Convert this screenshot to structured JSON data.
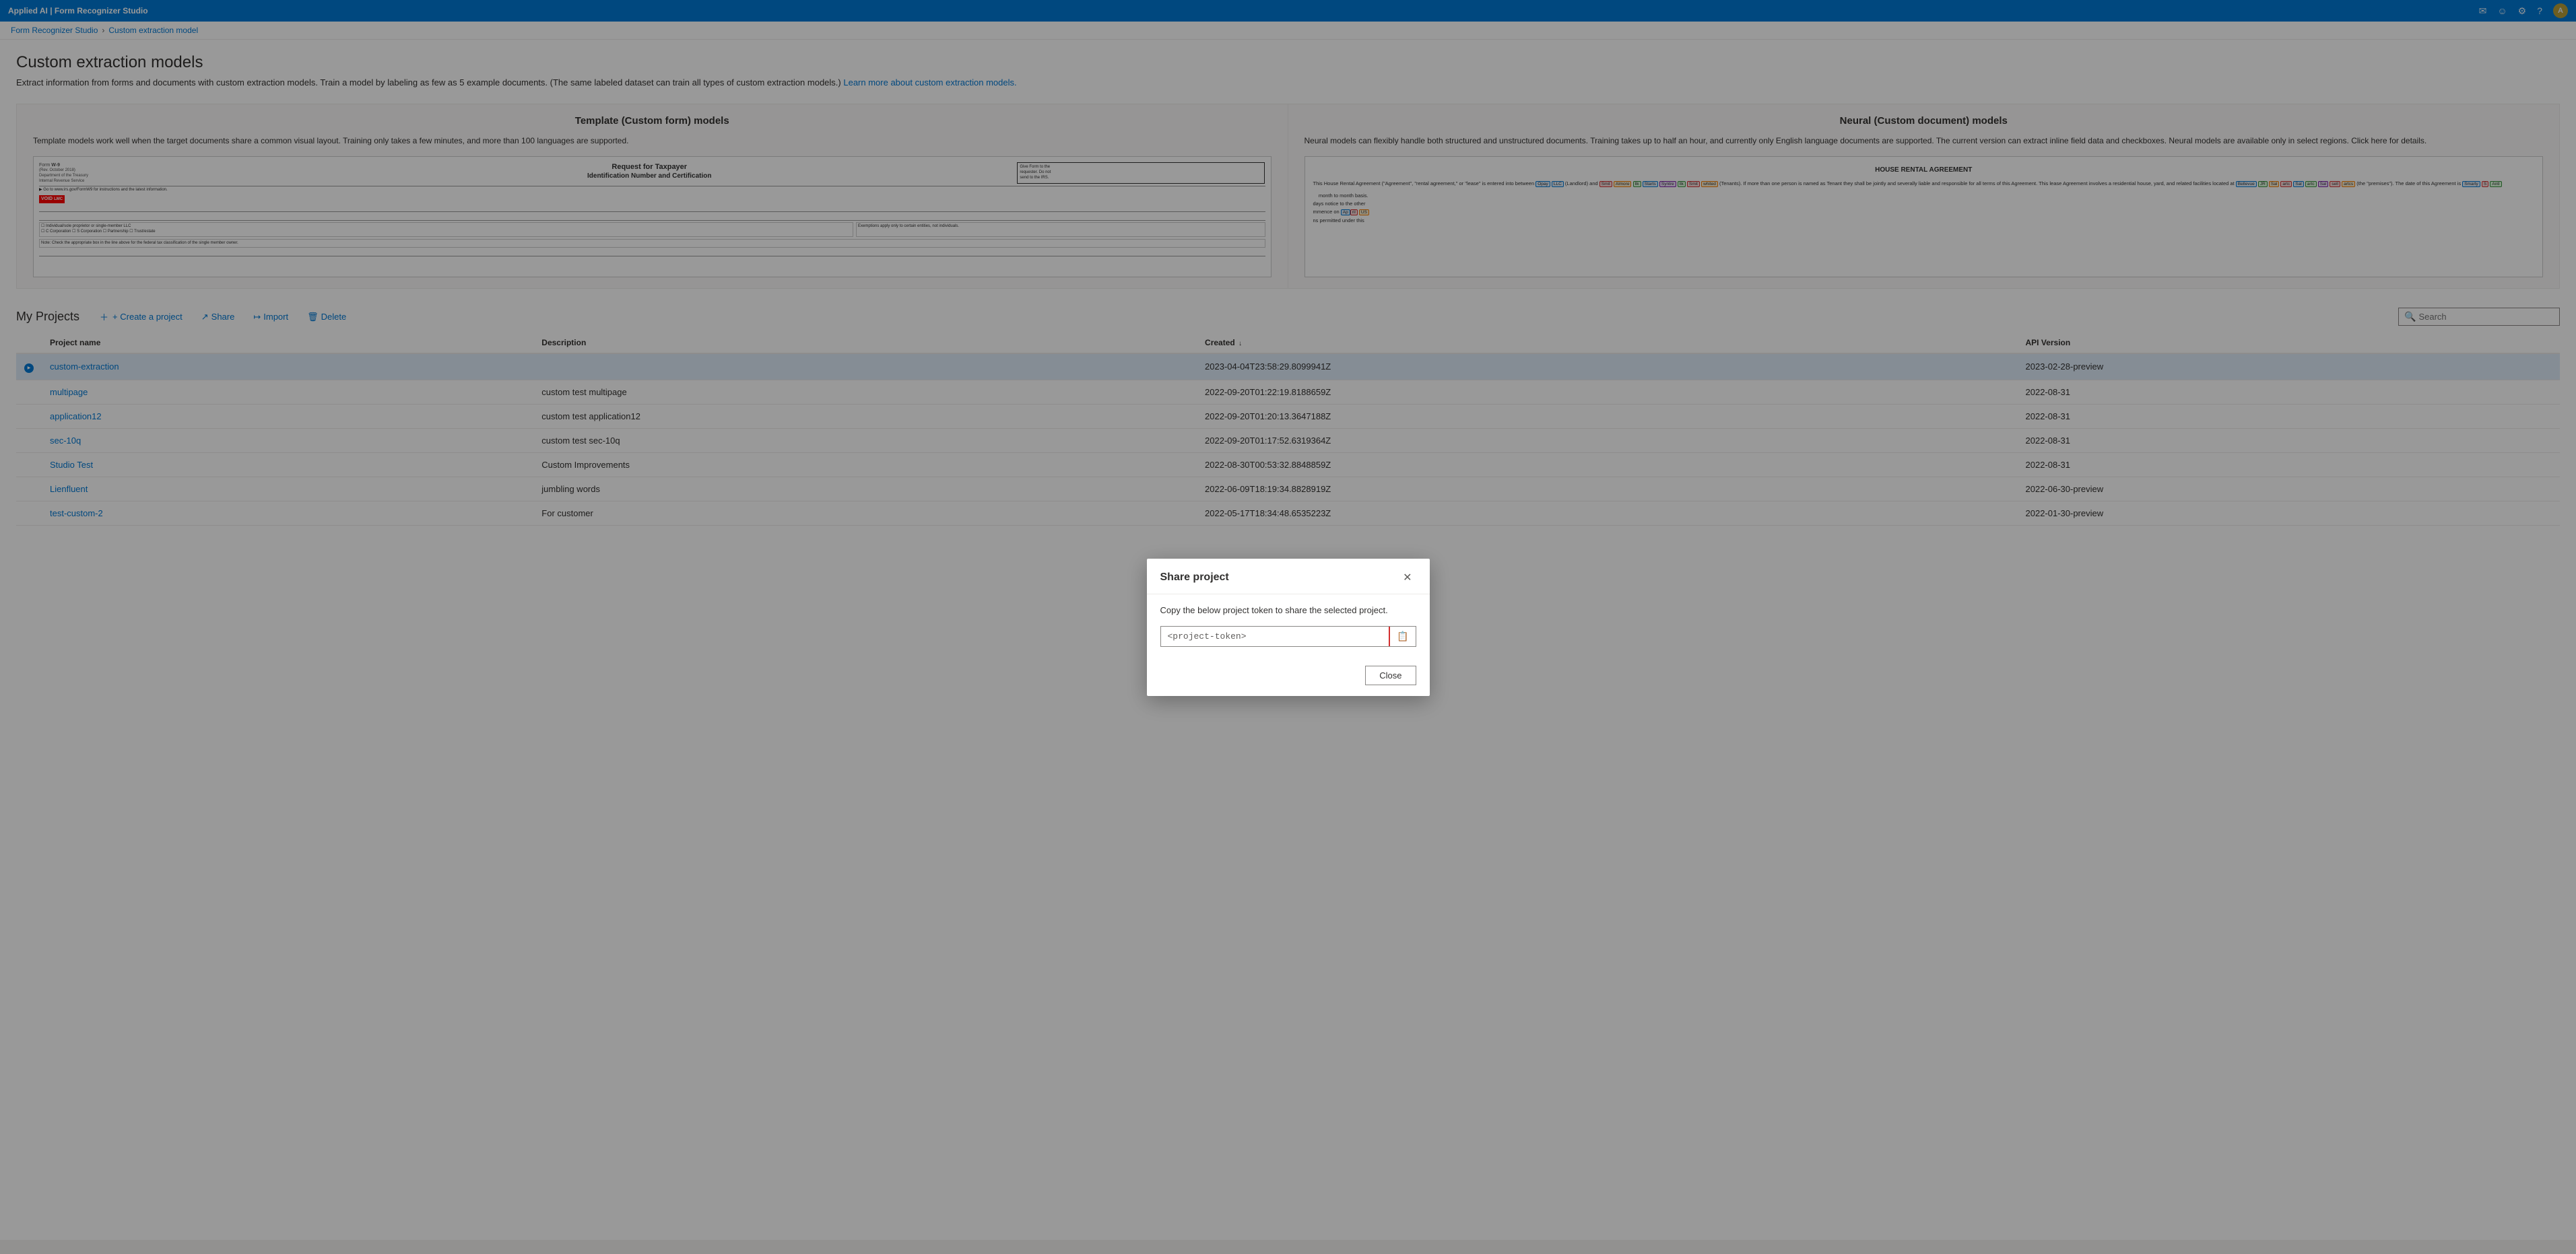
{
  "app": {
    "title": "Applied AI | Form Recognizer Studio",
    "topbar_icons": [
      "mail-icon",
      "smiley-icon",
      "settings-icon",
      "help-icon",
      "user-icon"
    ]
  },
  "breadcrumb": {
    "parent": "Form Recognizer Studio",
    "current": "Custom extraction model"
  },
  "page": {
    "title": "Custom extraction models",
    "description": "Extract information from forms and documents with custom extraction models. Train a model by labeling as few as 5 example documents. (The same labeled dataset can train all types of custom extraction models.)",
    "learn_more_text": "Learn more about custom extraction models.",
    "learn_more_url": "#"
  },
  "template_model": {
    "title": "Template (Custom form) models",
    "description": "Template models work well when the target documents share a common visual layout. Training only takes a few minutes, and more than 100 languages are supported."
  },
  "neural_model": {
    "title": "Neural (Custom document) models",
    "description": "Neural models can flexibly handle both structured and unstructured documents. Training takes up to half an hour, and currently only English language documents are supported. The current version can extract inline field data and checkboxes. Neural models are available only in select regions.",
    "click_here_text": "Click here",
    "details_text": " for details."
  },
  "projects": {
    "title": "My Projects",
    "actions": {
      "create": "+ Create a project",
      "share": "Share",
      "import": "Import",
      "delete": "Delete"
    },
    "search_placeholder": "Search",
    "table": {
      "columns": [
        "",
        "Project name",
        "Description",
        "Created ↓",
        "API Version"
      ],
      "rows": [
        {
          "id": 1,
          "selected": true,
          "indicator": true,
          "name": "custom-extraction",
          "description": "",
          "created": "2023-04-04T23:58:29.8099941Z",
          "api_version": "2023-02-28-preview"
        },
        {
          "id": 2,
          "selected": false,
          "indicator": false,
          "name": "multipage",
          "description": "custom test multipage",
          "created": "2022-09-20T01:22:19.8188659Z",
          "api_version": "2022-08-31"
        },
        {
          "id": 3,
          "selected": false,
          "indicator": false,
          "name": "application12",
          "description": "custom test application12",
          "created": "2022-09-20T01:20:13.3647188Z",
          "api_version": "2022-08-31"
        },
        {
          "id": 4,
          "selected": false,
          "indicator": false,
          "name": "sec-10q",
          "description": "custom test sec-10q",
          "created": "2022-09-20T01:17:52.6319364Z",
          "api_version": "2022-08-31"
        },
        {
          "id": 5,
          "selected": false,
          "indicator": false,
          "name": "Studio Test",
          "description": "Custom Improvements",
          "created": "2022-08-30T00:53:32.8848859Z",
          "api_version": "2022-08-31"
        },
        {
          "id": 6,
          "selected": false,
          "indicator": false,
          "name": "Lienfluent",
          "description": "jumbling words",
          "created": "2022-06-09T18:19:34.8828919Z",
          "api_version": "2022-06-30-preview"
        },
        {
          "id": 7,
          "selected": false,
          "indicator": false,
          "name": "test-custom-2",
          "description": "For customer",
          "created": "2022-05-17T18:34:48.6535223Z",
          "api_version": "2022-01-30-preview"
        }
      ]
    }
  },
  "modal": {
    "title": "Share project",
    "description": "Copy the below project token to share the selected project.",
    "token_placeholder": "<project-token>",
    "token_value": "<project-token>",
    "close_label": "Close",
    "copy_icon": "📋"
  }
}
